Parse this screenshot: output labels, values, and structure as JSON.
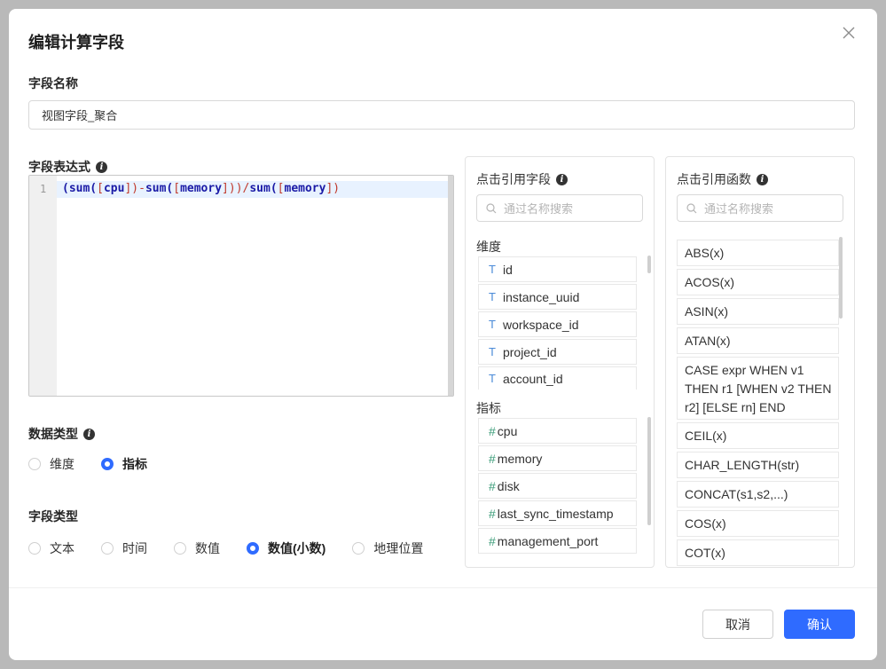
{
  "dialog": {
    "title": "编辑计算字段"
  },
  "field_name": {
    "label": "字段名称",
    "value": "视图字段_聚合"
  },
  "expression": {
    "label": "字段表达式",
    "line_number": "1",
    "code_parts": [
      "(",
      "sum(",
      "[",
      "cpu",
      "]",
      ")-",
      "sum(",
      "[",
      "memory",
      "]",
      "))/",
      "sum(",
      "[",
      "memory",
      "]",
      ")"
    ]
  },
  "data_type": {
    "label": "数据类型",
    "options": [
      "维度",
      "指标"
    ],
    "selected": "指标"
  },
  "field_type": {
    "label": "字段类型",
    "options": [
      "文本",
      "时间",
      "数值",
      "数值(小数)",
      "地理位置"
    ],
    "selected": "数值(小数)"
  },
  "fields_panel": {
    "title": "点击引用字段",
    "search_placeholder": "通过名称搜索",
    "dimension_label": "维度",
    "dimension_icon": "T",
    "dimensions": [
      "id",
      "instance_uuid",
      "workspace_id",
      "project_id",
      "account_id"
    ],
    "metric_label": "指标",
    "metric_icon": "#",
    "metrics": [
      "cpu",
      "memory",
      "disk",
      "last_sync_timestamp",
      "management_port"
    ]
  },
  "functions_panel": {
    "title": "点击引用函数",
    "search_placeholder": "通过名称搜索",
    "functions": [
      "ABS(x)",
      "ACOS(x)",
      "ASIN(x)",
      "ATAN(x)",
      "CASE expr WHEN v1 THEN r1 [WHEN v2 THEN r2] [ELSE rn] END",
      "CEIL(x)",
      "CHAR_LENGTH(str)",
      "CONCAT(s1,s2,...)",
      "COS(x)",
      "COT(x)"
    ]
  },
  "footer": {
    "cancel_label": "取消",
    "ok_label": "确认"
  },
  "colors": {
    "primary": "#2f6bff",
    "code_keyword": "#1a1aa6",
    "code_bracket": "#c0392b"
  }
}
